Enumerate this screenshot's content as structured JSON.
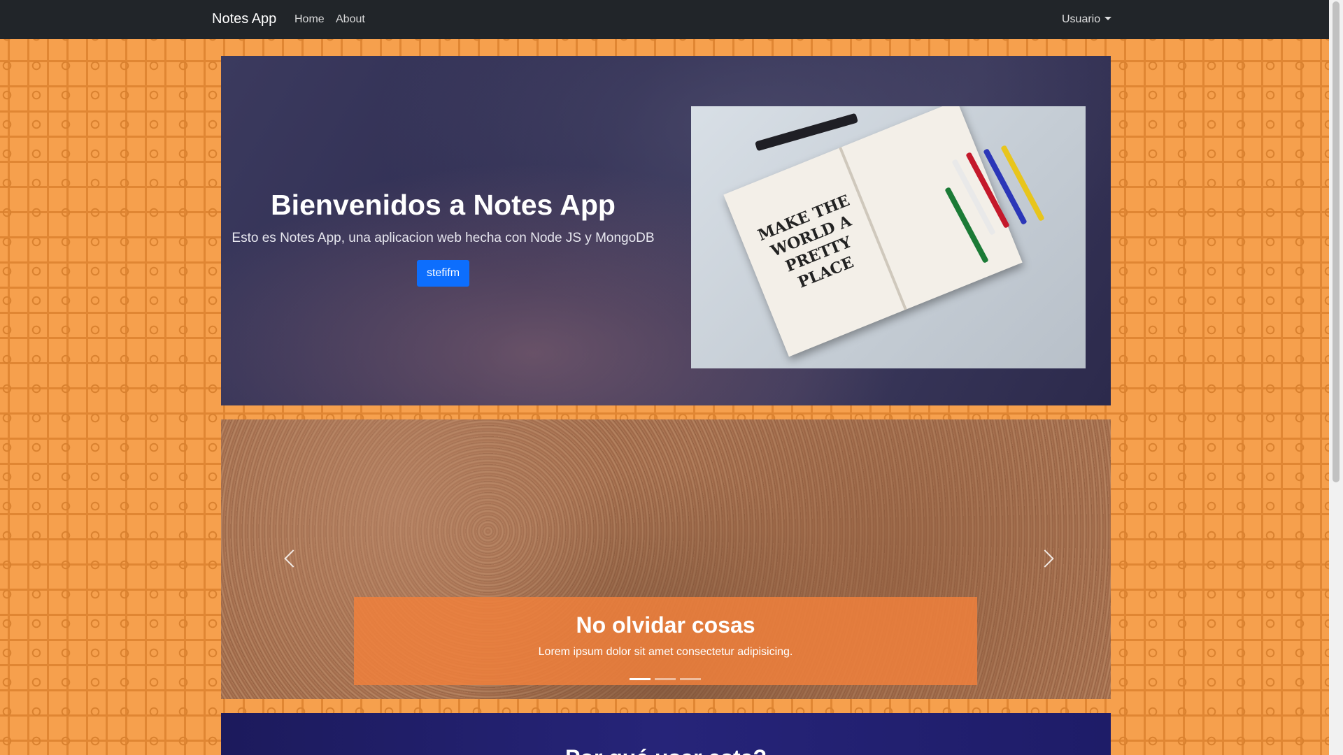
{
  "navbar": {
    "brand": "Notes App",
    "links": [
      "Home",
      "About"
    ],
    "user_menu": "Usuario"
  },
  "hero": {
    "title": "Bienvenidos a Notes App",
    "subtitle": "Esto es Notes App, una aplicacion web hecha con Node JS y MongoDB",
    "button": "stefifm",
    "image_text": "MAKE THE WORLD A PRETTY PLACE"
  },
  "carousel": {
    "caption_title": "No olvidar cosas",
    "caption_text": "Lorem ipsum dolor sit amet consectetur adipisicing.",
    "slide_count": 3,
    "active_slide": 1
  },
  "section3": {
    "title_partial": "Por qué usar esta?"
  },
  "colors": {
    "navbar_bg": "#212529",
    "background_orange": "#f6a04d",
    "primary_button": "#0d6efd",
    "caption_orange": "#f0803c"
  }
}
